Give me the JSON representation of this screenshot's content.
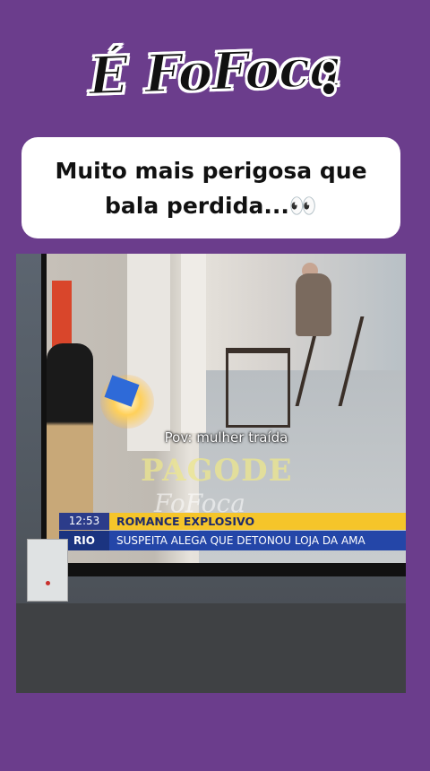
{
  "logo": {
    "text": "É FoFoca"
  },
  "caption": {
    "text": "Muito mais perigosa que bala perdida...👀"
  },
  "video": {
    "overlay_text": "Pov: mulher traída",
    "watermark_text": "PAGODE",
    "watermark_sub": "FoFoca",
    "ticker_time": "12:53",
    "ticker_headline": "ROMANCE EXPLOSIVO",
    "ticker_station": "RIO",
    "ticker_news": "SUSPEITA ALEGA QUE DETONOU LOJA DA AMA"
  },
  "colors": {
    "background": "#6b3d8c",
    "caption_bg": "#ffffff",
    "ticker_yellow": "#f5c52a",
    "ticker_blue": "#2446a8"
  }
}
